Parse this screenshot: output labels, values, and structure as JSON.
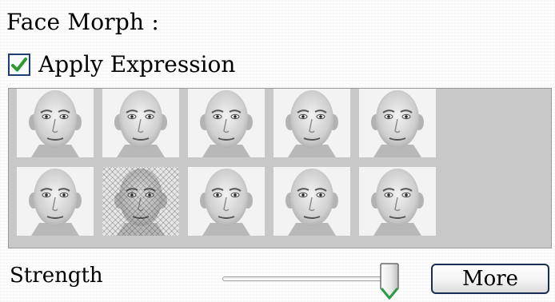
{
  "panel": {
    "title": "Face Morph :",
    "apply_expression": {
      "label": "Apply Expression",
      "checked": true,
      "check_color": "#2e9a2e"
    }
  },
  "expressions": {
    "count": 10,
    "selected_index": 6,
    "background_color": "#c8c8c8"
  },
  "strength": {
    "label": "Strength",
    "level": 0.93,
    "thumb_color": "#2f9a4a"
  },
  "more_button": {
    "label": "More"
  }
}
